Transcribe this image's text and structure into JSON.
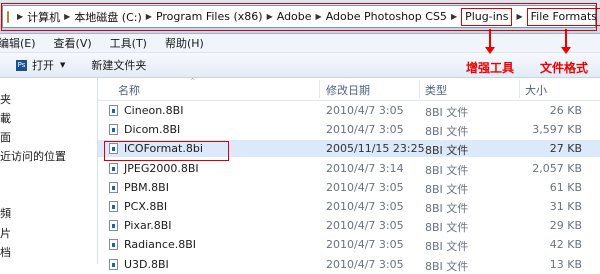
{
  "address_bar": {
    "crumbs": [
      "计算机",
      "本地磁盘 (C:)",
      "Program Files (x86)",
      "Adobe",
      "Adobe Photoshop CS5",
      "Plug-ins",
      "File Formats"
    ],
    "separator": "▶"
  },
  "menu": [
    "编辑(E)",
    "查看(V)",
    "工具(T)",
    "帮助(H)"
  ],
  "toolbar": {
    "open_label": "打开",
    "app_badge": "Ps",
    "dropdown_glyph": "▼",
    "new_folder_label": "新建文件夹"
  },
  "annotations": {
    "plugins_label": "增强工具",
    "fileformats_label": "文件格式"
  },
  "nav": [
    "夹",
    "載",
    "面",
    "近访问的位置",
    "",
    "頻",
    "片",
    "档"
  ],
  "columns": {
    "name": "名称",
    "date": "修改日期",
    "type": "类型",
    "size": "大小"
  },
  "files": [
    {
      "name": "Cineon.8BI",
      "date": "2010/4/7 3:05",
      "type": "8BI 文件",
      "size": "26 KB",
      "selected": false
    },
    {
      "name": "Dicom.8BI",
      "date": "2010/4/7 3:05",
      "type": "8BI 文件",
      "size": "3,597 KB",
      "selected": false
    },
    {
      "name": "ICOFormat.8bi",
      "date": "2005/11/15 23:25",
      "type": "8BI 文件",
      "size": "27 KB",
      "selected": true
    },
    {
      "name": "JPEG2000.8BI",
      "date": "2010/4/7 3:14",
      "type": "8BI 文件",
      "size": "2,057 KB",
      "selected": false
    },
    {
      "name": "PBM.8BI",
      "date": "2010/4/7 3:05",
      "type": "8BI 文件",
      "size": "61 KB",
      "selected": false
    },
    {
      "name": "PCX.8BI",
      "date": "2010/4/7 3:05",
      "type": "8BI 文件",
      "size": "31 KB",
      "selected": false
    },
    {
      "name": "Pixar.8BI",
      "date": "2010/4/7 3:05",
      "type": "8BI 文件",
      "size": "29 KB",
      "selected": false
    },
    {
      "name": "Radiance.8BI",
      "date": "2010/4/7 3:05",
      "type": "8BI 文件",
      "size": "42 KB",
      "selected": false
    },
    {
      "name": "U3D.8BI",
      "date": "2010/4/7 3:05",
      "type": "8BI 文件",
      "size": "13 KB",
      "selected": false
    }
  ]
}
